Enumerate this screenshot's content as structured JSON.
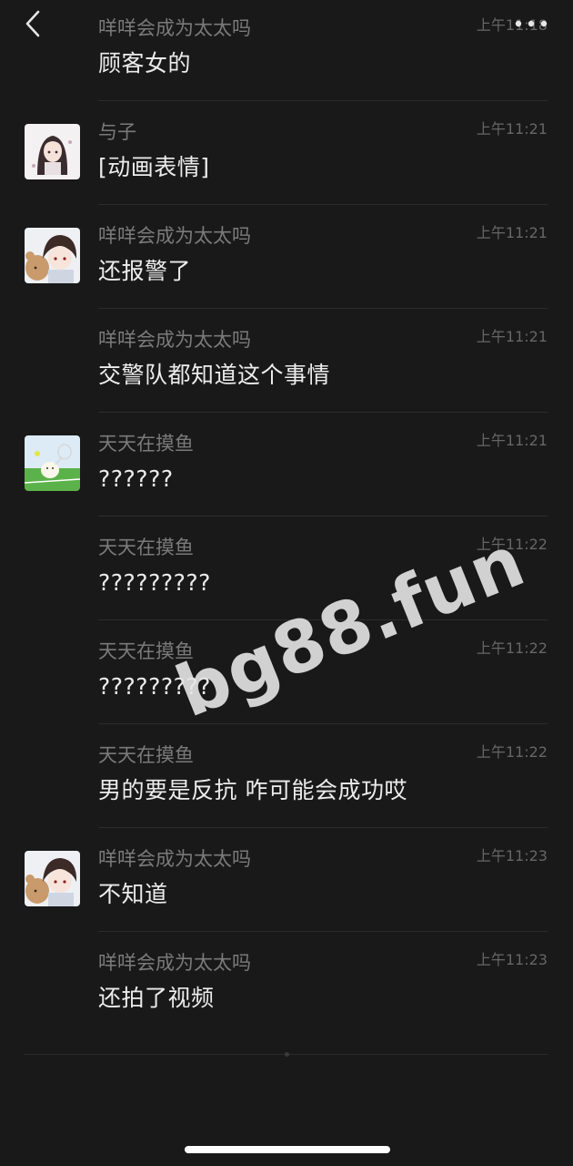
{
  "nav": {
    "back_icon": "chevron-left-icon",
    "more_icon": "more-dots-icon"
  },
  "messages": [
    {
      "name": "咩咩会成为太太吗",
      "time": "上午11:18",
      "text": "顾客女的",
      "avatar": "none"
    },
    {
      "name": "与子",
      "time": "上午11:21",
      "text": "[动画表情]",
      "avatar": "anime-girl"
    },
    {
      "name": "咩咩会成为太太吗",
      "time": "上午11:21",
      "text": "还报警了",
      "avatar": "boy-with-bear"
    },
    {
      "name": "咩咩会成为太太吗",
      "time": "上午11:21",
      "text": "交警队都知道这个事情",
      "avatar": "none"
    },
    {
      "name": "天天在摸鱼",
      "time": "上午11:21",
      "text": "??????",
      "avatar": "tennis-duck"
    },
    {
      "name": "天天在摸鱼",
      "time": "上午11:22",
      "text": "?????????",
      "avatar": "none"
    },
    {
      "name": "天天在摸鱼",
      "time": "上午11:22",
      "text": "?????????",
      "avatar": "none"
    },
    {
      "name": "天天在摸鱼",
      "time": "上午11:22",
      "text": "男的要是反抗  咋可能会成功哎",
      "avatar": "none"
    },
    {
      "name": "咩咩会成为太太吗",
      "time": "上午11:23",
      "text": "不知道",
      "avatar": "boy-with-bear"
    },
    {
      "name": "咩咩会成为太太吗",
      "time": "上午11:23",
      "text": "还拍了视频",
      "avatar": "none"
    }
  ],
  "watermark": "bg88.fun"
}
